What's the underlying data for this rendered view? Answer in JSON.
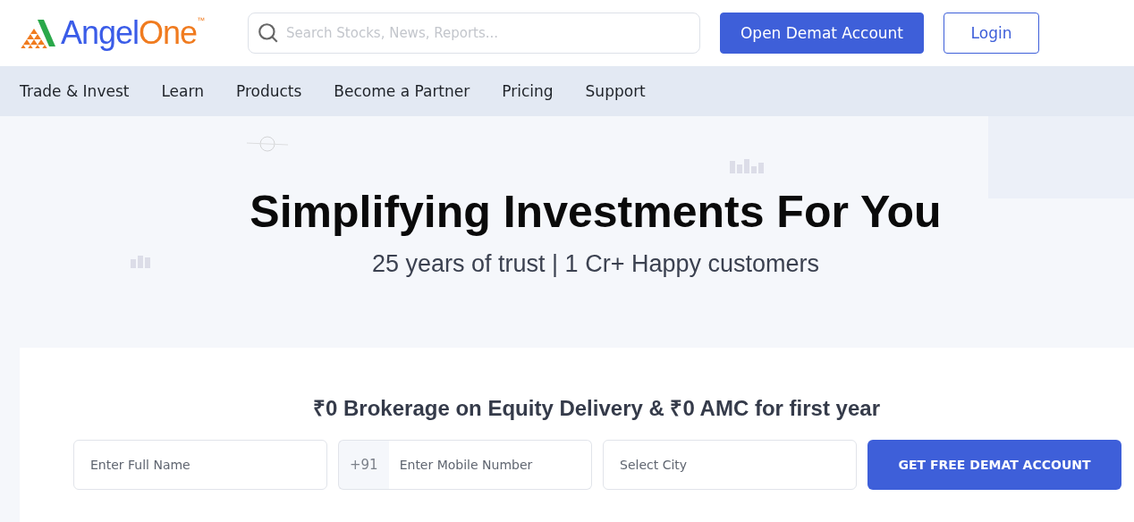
{
  "header": {
    "logo": {
      "first": "Angel",
      "second": "One",
      "mark": "™"
    },
    "search": {
      "placeholder": "Search Stocks, News, Reports..."
    },
    "buttons": [
      {
        "label": "Open Demat Account",
        "kind": "primary"
      },
      {
        "label": "Login",
        "kind": "outline"
      }
    ]
  },
  "nav": {
    "items": [
      "Trade & Invest",
      "Learn",
      "Products",
      "Become a Partner",
      "Pricing",
      "Support"
    ]
  },
  "hero": {
    "title": "Simplifying Investments For You",
    "subtitle": "25 years of trust | 1 Cr+ Happy customers"
  },
  "signup": {
    "heading": "₹0 Brokerage on Equity Delivery & ₹0 AMC for first year",
    "fields": [
      {
        "kind": "text",
        "placeholder": "Enter Full Name"
      },
      {
        "kind": "phone",
        "prefix": "+91",
        "placeholder": "Enter Mobile Number"
      },
      {
        "kind": "select",
        "placeholder": "Select City"
      }
    ],
    "submit": "GET FREE DEMAT ACCOUNT"
  }
}
